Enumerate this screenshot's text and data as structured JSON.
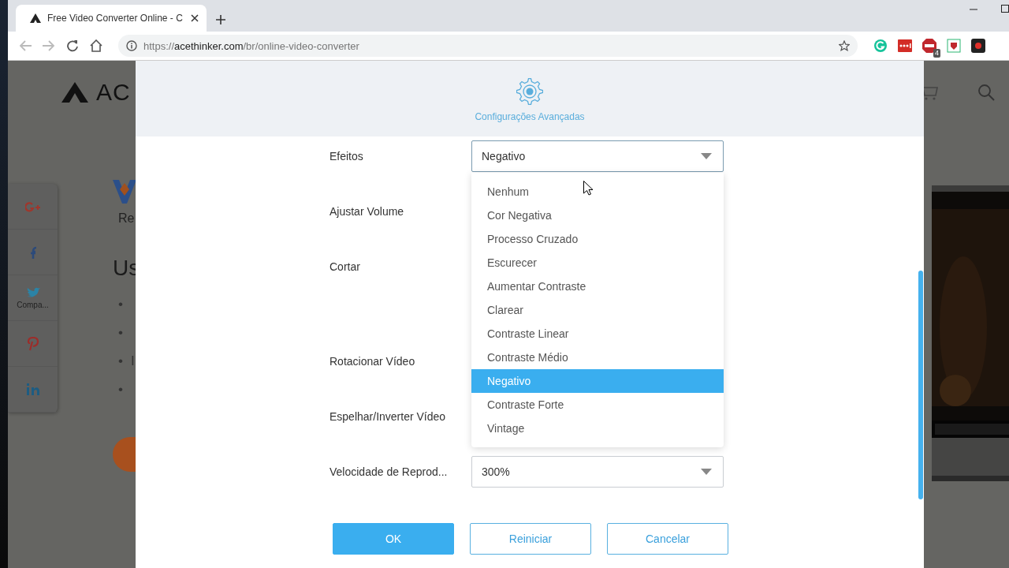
{
  "browser": {
    "tab_title": "Free Video Converter Online - C",
    "url_scheme": "https://",
    "url_domain": "acethinker.com",
    "url_path": "/br/online-video-converter",
    "extension_badge": "4"
  },
  "background_page": {
    "logo_text": "AC",
    "share_label": "Compa...",
    "subtitle": "Re",
    "heading": "Us",
    "bullets": [
      {
        "mark": "•"
      },
      {
        "mark": "•"
      },
      {
        "mark": "•",
        "text": "I"
      },
      {
        "mark": "•"
      }
    ]
  },
  "dialog": {
    "title": "Configurações Avançadas",
    "fields": [
      {
        "label": "Efeitos",
        "kind": "dropdown",
        "value": "Negativo",
        "expanded": true
      },
      {
        "label": "Ajustar Volume",
        "kind": "covered"
      },
      {
        "label": "Cortar",
        "kind": "covered"
      },
      {
        "label": "Rotacionar Vídeo",
        "kind": "covered"
      },
      {
        "label": "Espelhar/Inverter Vídeo",
        "kind": "covered"
      },
      {
        "label": "Velocidade de Reprod...",
        "kind": "dropdown",
        "value": "300%",
        "expanded": false
      }
    ],
    "effect_options": [
      {
        "label": "Nenhum",
        "selected": false
      },
      {
        "label": "Cor Negativa",
        "selected": false
      },
      {
        "label": "Processo Cruzado",
        "selected": false
      },
      {
        "label": "Escurecer",
        "selected": false
      },
      {
        "label": "Aumentar Contraste",
        "selected": false
      },
      {
        "label": "Clarear",
        "selected": false
      },
      {
        "label": "Contraste Linear",
        "selected": false
      },
      {
        "label": "Contraste Médio",
        "selected": false
      },
      {
        "label": "Negativo",
        "selected": true
      },
      {
        "label": "Contraste Forte",
        "selected": false
      },
      {
        "label": "Vintage",
        "selected": false
      }
    ],
    "buttons": [
      {
        "label": "OK",
        "kind": "primary"
      },
      {
        "label": "Reiniciar",
        "kind": "secondary"
      },
      {
        "label": "Cancelar",
        "kind": "secondary"
      }
    ]
  }
}
